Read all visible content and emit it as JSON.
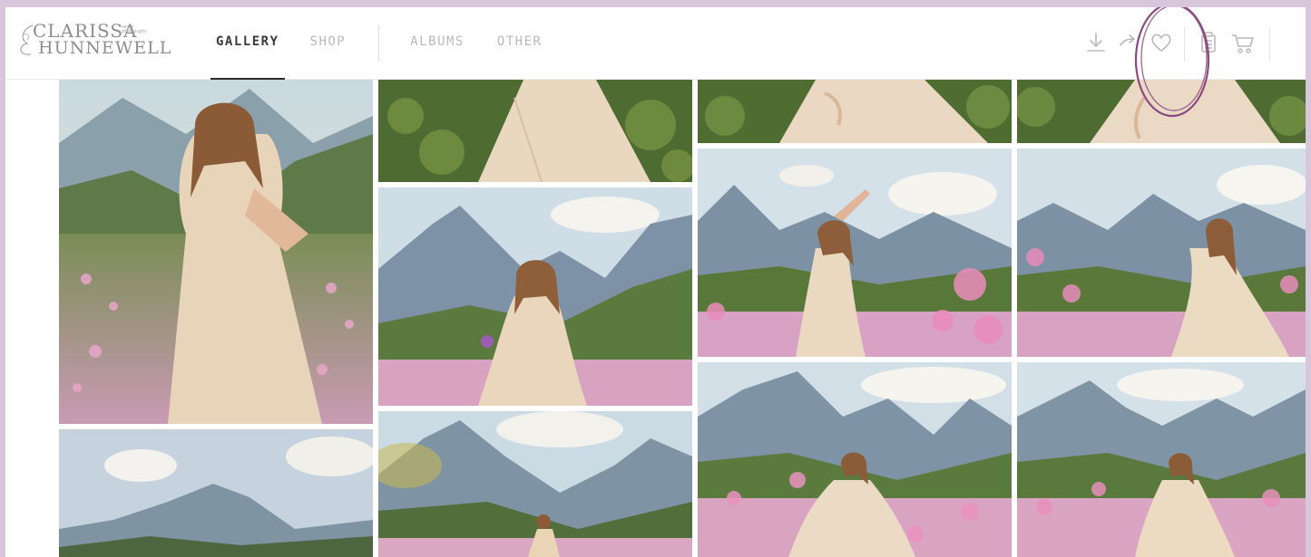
{
  "brand": {
    "name_line1": "CLARISSA",
    "name_line2": "HUNNEWELL",
    "tagline": "senior photography"
  },
  "nav": {
    "items": [
      {
        "label": "GALLERY",
        "active": true
      },
      {
        "label": "SHOP",
        "active": false
      },
      {
        "label": "ALBUMS",
        "active": false
      },
      {
        "label": "OTHER",
        "active": false
      }
    ]
  },
  "actions": {
    "icons": [
      "download-icon",
      "share-icon",
      "heart-icon",
      "clipboard-icon",
      "cart-icon"
    ]
  },
  "colors": {
    "background": "#d8c6dc",
    "annotation": "#8c4a82",
    "nav_active": "#2b2b2b",
    "nav_inactive": "#b9b9b9"
  },
  "gallery": {
    "photos": [
      {
        "scene": "portrait-field"
      },
      {
        "scene": "dress-crop"
      },
      {
        "scene": "dress-crop"
      },
      {
        "scene": "dress-crop"
      },
      {
        "scene": "mountain-portrait-closeup"
      },
      {
        "scene": "arm-raised-wildflowers"
      },
      {
        "scene": "twirl-mountain-meadow"
      },
      {
        "scene": "mountain-clouds"
      },
      {
        "scene": "mountain-meadow-far"
      },
      {
        "scene": "dancing-meadow"
      },
      {
        "scene": "meadow-wide"
      }
    ]
  }
}
